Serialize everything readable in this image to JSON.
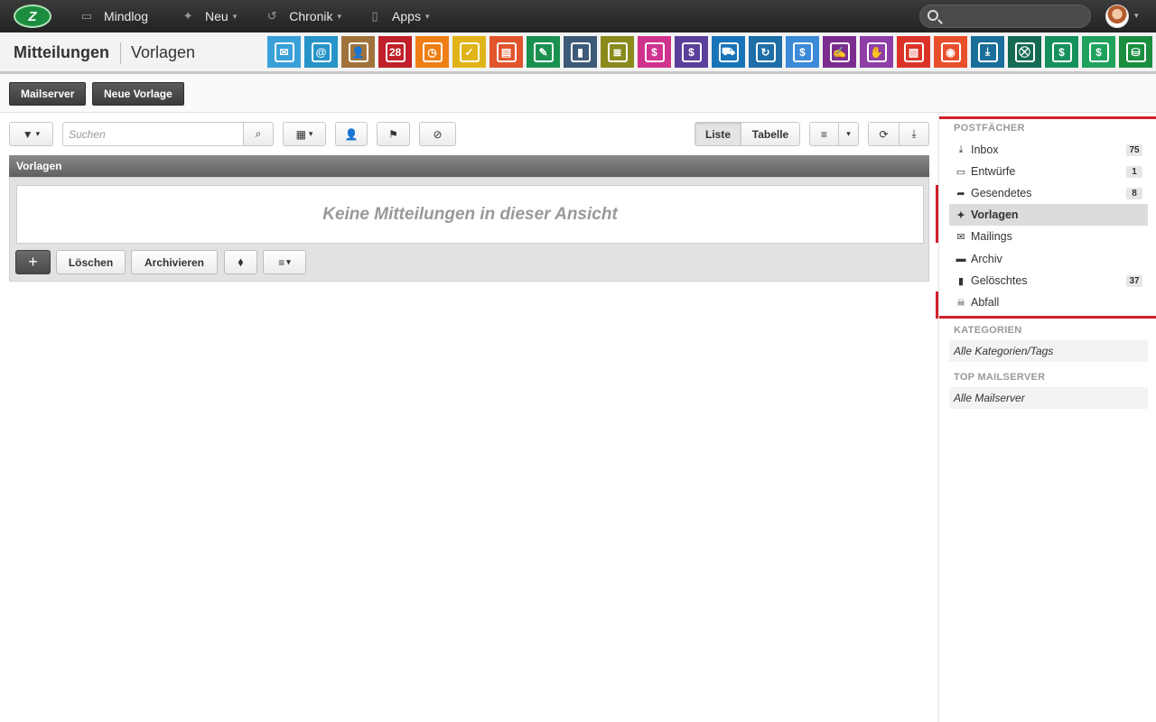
{
  "nav": {
    "logo_text": "Z",
    "items": [
      {
        "label": "Mindlog",
        "icon": "screens-icon",
        "glyph": "▭"
      },
      {
        "label": "Neu",
        "icon": "sparkle-icon",
        "glyph": "✦"
      },
      {
        "label": "Chronik",
        "icon": "history-icon",
        "glyph": "↺"
      },
      {
        "label": "Apps",
        "icon": "tablet-icon",
        "glyph": "▯"
      }
    ]
  },
  "header": {
    "title": "Mitteilungen",
    "subtitle": "Vorlagen"
  },
  "app_icons": [
    {
      "name": "mail-app-icon",
      "color": "#3aa0d8",
      "glyph": "✉"
    },
    {
      "name": "address-book-app-icon",
      "color": "#2694c8",
      "glyph": "@"
    },
    {
      "name": "contacts-app-icon",
      "color": "#a0733c",
      "glyph": "👤"
    },
    {
      "name": "calendar-app-icon",
      "color": "#c0202a",
      "glyph": "28"
    },
    {
      "name": "timer-app-icon",
      "color": "#ef7e14",
      "glyph": "◷"
    },
    {
      "name": "tasks-app-icon",
      "color": "#e0b418",
      "glyph": "✓"
    },
    {
      "name": "projects-app-icon",
      "color": "#e2552c",
      "glyph": "▤"
    },
    {
      "name": "notes-app-icon",
      "color": "#1a9150",
      "glyph": "✎"
    },
    {
      "name": "bookmark-app-icon",
      "color": "#3d5a78",
      "glyph": "▮"
    },
    {
      "name": "documents-app-icon",
      "color": "#8a8a1c",
      "glyph": "≣"
    },
    {
      "name": "helpdesk-app-icon",
      "color": "#d0338e",
      "glyph": "$"
    },
    {
      "name": "finance-app-icon",
      "color": "#5b3f9a",
      "glyph": "$"
    },
    {
      "name": "delivery-app-icon",
      "color": "#1874b8",
      "glyph": "⛟"
    },
    {
      "name": "purchasing-app-icon",
      "color": "#1e6ea8",
      "glyph": "↻"
    },
    {
      "name": "money-bag-app-icon",
      "color": "#3c8ad8",
      "glyph": "$"
    },
    {
      "name": "contracts-app-icon",
      "color": "#7a2d8e",
      "glyph": "✍"
    },
    {
      "name": "partners-app-icon",
      "color": "#8e3fa8",
      "glyph": "✋"
    },
    {
      "name": "pdf-app-icon",
      "color": "#dc3328",
      "glyph": "▧"
    },
    {
      "name": "broadcast-app-icon",
      "color": "#e8502c",
      "glyph": "◉"
    },
    {
      "name": "download-app-icon",
      "color": "#1b6e9a",
      "glyph": "⤓"
    },
    {
      "name": "cart-app-icon",
      "color": "#146a52",
      "glyph": "⛒"
    },
    {
      "name": "cash-app-icon",
      "color": "#16915e",
      "glyph": "$"
    },
    {
      "name": "pricetag-app-icon",
      "color": "#1ea25c",
      "glyph": "$"
    },
    {
      "name": "database-app-icon",
      "color": "#1b8e40",
      "glyph": "⛁"
    }
  ],
  "actions": {
    "mailserver": "Mailserver",
    "new_template": "Neue Vorlage"
  },
  "toolbar": {
    "search_placeholder": "Suchen",
    "view_list": "Liste",
    "view_table": "Tabelle"
  },
  "panel": {
    "title": "Vorlagen",
    "empty_text": "Keine Mitteilungen in dieser Ansicht",
    "add": "+",
    "delete": "Löschen",
    "archive": "Archivieren"
  },
  "sidebar": {
    "mailboxes_header": "POSTFÄCHER",
    "mailboxes": [
      {
        "label": "Inbox",
        "count": "75",
        "glyph": "⤓"
      },
      {
        "label": "Entwürfe",
        "count": "1",
        "glyph": "▭"
      },
      {
        "label": "Gesendetes",
        "count": "8",
        "glyph": "➦"
      },
      {
        "label": "Vorlagen",
        "count": "",
        "glyph": "✦"
      },
      {
        "label": "Mailings",
        "count": "",
        "glyph": "✉"
      },
      {
        "label": "Archiv",
        "count": "",
        "glyph": "▬"
      },
      {
        "label": "Gelöschtes",
        "count": "37",
        "glyph": "▮"
      },
      {
        "label": "Abfall",
        "count": "",
        "glyph": "☠"
      }
    ],
    "categories_header": "KATEGORIEN",
    "categories_all": "Alle Kategorien/Tags",
    "mailserver_header": "TOP MAILSERVER",
    "mailserver_all": "Alle Mailserver"
  }
}
